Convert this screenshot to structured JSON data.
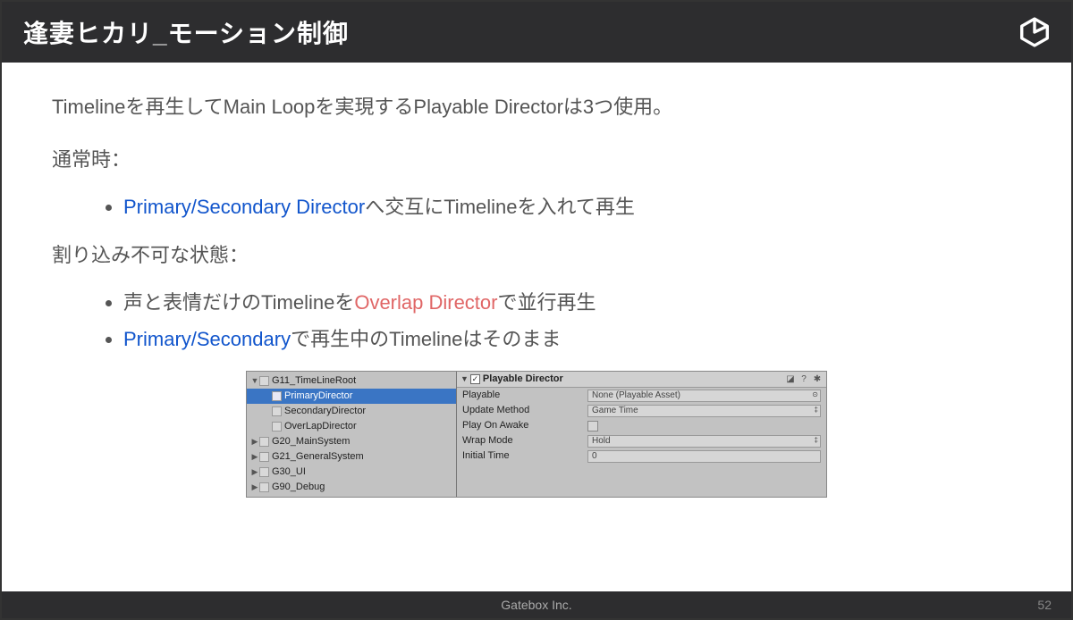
{
  "header": {
    "title": "逢妻ヒカリ_モーション制御"
  },
  "content": {
    "intro": "Timelineを再生してMain Loopを実現するPlayable Directorは3つ使用。",
    "normal_label": "通常時：",
    "bullet1": {
      "seg1": "Primary/Secondary Director",
      "seg2": "へ交互にTimelineを入れて再生"
    },
    "interrupt_label": "割り込み不可な状態：",
    "bullet2": {
      "seg1": "声と表情だけのTimelineを",
      "seg2": "Overlap Director",
      "seg3": "で並行再生"
    },
    "bullet3": {
      "seg1": "Primary/Secondary",
      "seg2": "で再生中のTimelineはそのまま"
    }
  },
  "hierarchy": {
    "items": [
      {
        "name": "G11_TimeLineRoot",
        "indent": 0,
        "arrow": "▼",
        "selected": false
      },
      {
        "name": "PrimaryDirector",
        "indent": 1,
        "arrow": "",
        "selected": true
      },
      {
        "name": "SecondaryDirector",
        "indent": 1,
        "arrow": "",
        "selected": false
      },
      {
        "name": "OverLapDirector",
        "indent": 1,
        "arrow": "",
        "selected": false
      },
      {
        "name": "G20_MainSystem",
        "indent": 0,
        "arrow": "▶",
        "selected": false
      },
      {
        "name": "G21_GeneralSystem",
        "indent": 0,
        "arrow": "▶",
        "selected": false
      },
      {
        "name": "G30_UI",
        "indent": 0,
        "arrow": "▶",
        "selected": false
      },
      {
        "name": "G90_Debug",
        "indent": 0,
        "arrow": "▶",
        "selected": false
      }
    ]
  },
  "inspector": {
    "title": "Playable Director",
    "rows": {
      "playable": {
        "label": "Playable",
        "value": "None (Playable Asset)"
      },
      "update": {
        "label": "Update Method",
        "value": "Game Time"
      },
      "awake": {
        "label": "Play On Awake"
      },
      "wrap": {
        "label": "Wrap Mode",
        "value": "Hold"
      },
      "initial": {
        "label": "Initial Time",
        "value": "0"
      }
    }
  },
  "footer": {
    "company": "Gatebox Inc.",
    "page": "52"
  }
}
